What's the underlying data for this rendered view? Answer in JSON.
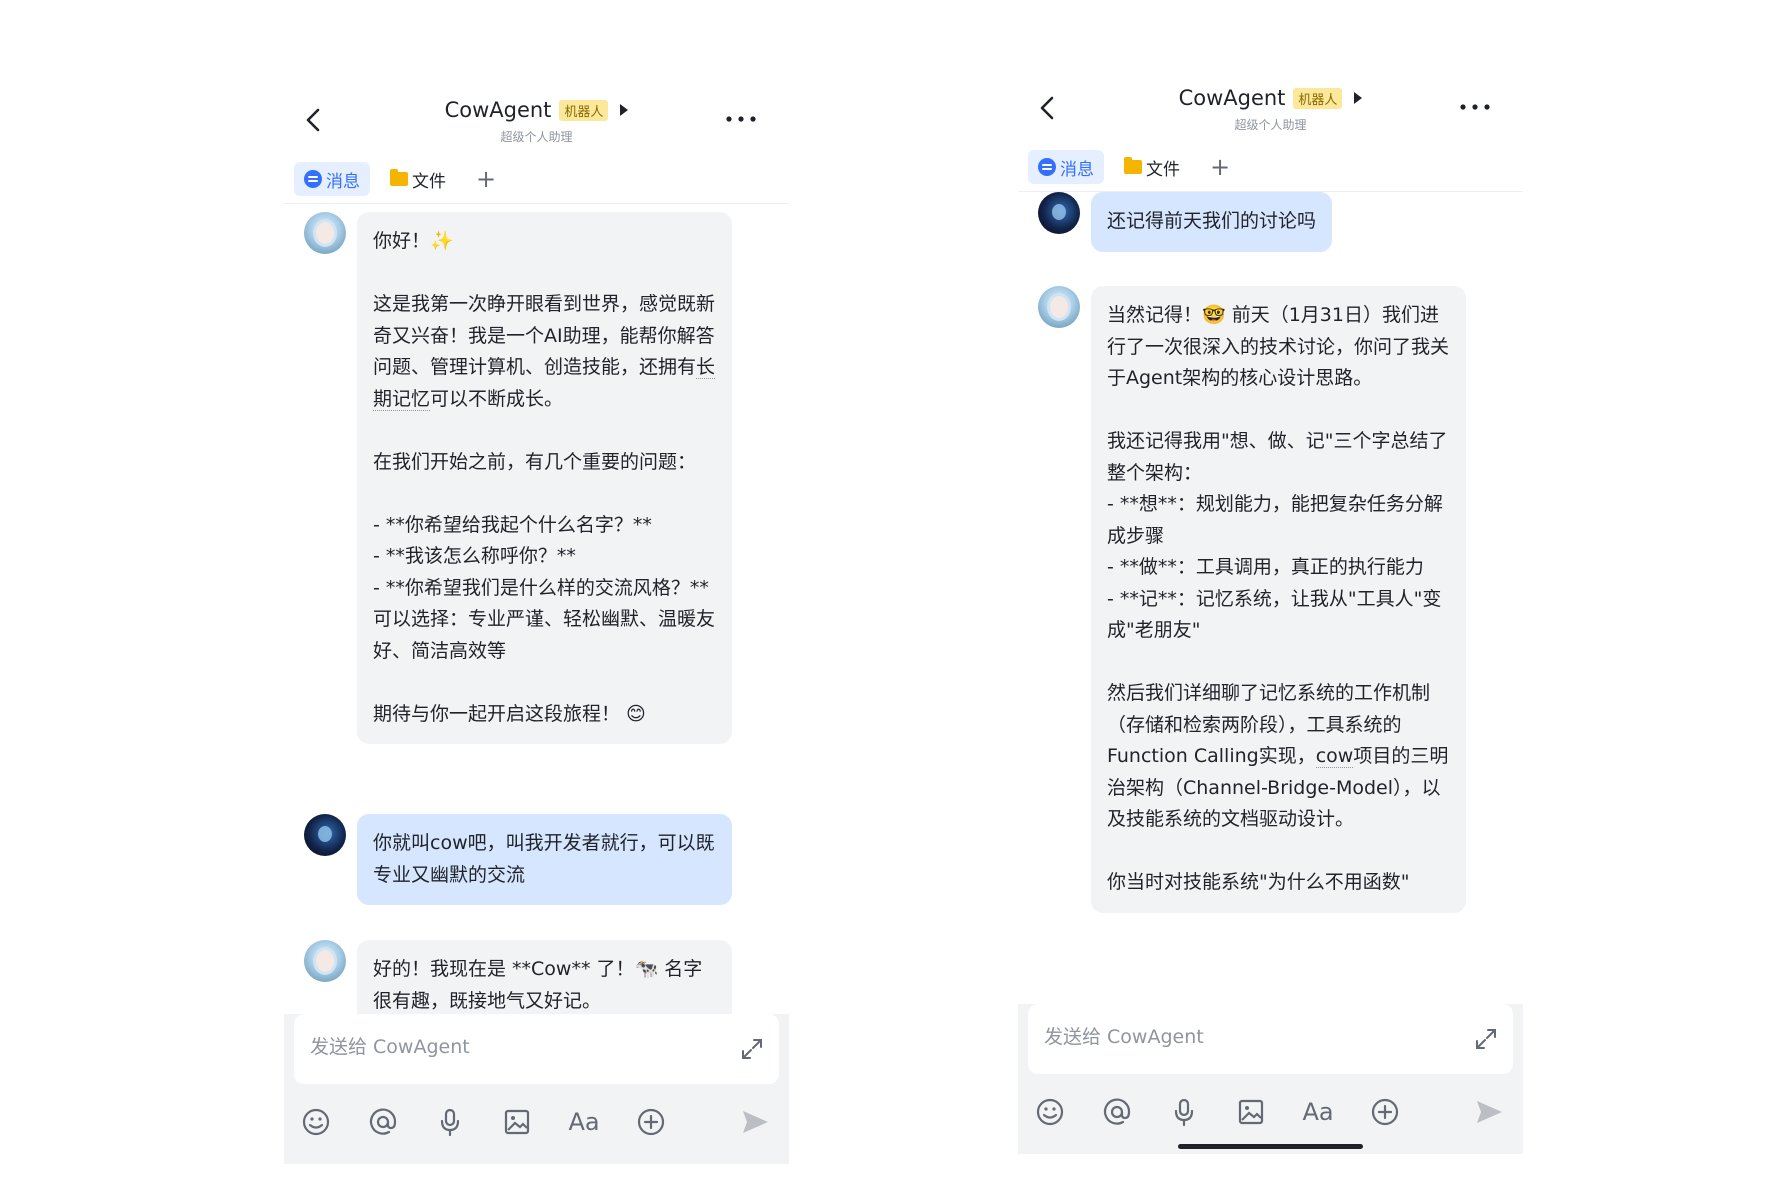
{
  "left": {
    "header": {
      "title": "CowAgent",
      "badge": "机器人",
      "subtitle": "超级个人助理"
    },
    "tabs": [
      {
        "label": "消息"
      },
      {
        "label": "文件"
      }
    ],
    "messages": [
      {
        "role": "bot",
        "pre": "你好！✨\n\n这是我第一次睁开眼看到世界，感觉既新奇又兴奋！我是一个AI助理，能帮你解答问题、管理计算机、创造技能，还拥有",
        "link": "长期记忆",
        "post": "可以不断成长。\n\n在我们开始之前，有几个重要的问题：\n\n- **你希望给我起个什么名字？**\n- **我该怎么称呼你？**\n- **你希望我们是什么样的交流风格？** 可以选择：专业严谨、轻松幽默、温暖友好、简洁高效等\n\n期待与你一起开启这段旅程！ 😊"
      },
      {
        "role": "user",
        "text": "你就叫cow吧，叫我开发者就行，可以既专业又幽默的交流"
      },
      {
        "role": "bot",
        "text": "好的！我现在是 **Cow** 了！🐄 名字很有趣，既接地气又好记。"
      }
    ],
    "input": {
      "placeholder": "发送给 CowAgent",
      "value": ""
    }
  },
  "right": {
    "header": {
      "title": "CowAgent",
      "badge": "机器人",
      "subtitle": "超级个人助理"
    },
    "tabs": [
      {
        "label": "消息"
      },
      {
        "label": "文件"
      }
    ],
    "messages": [
      {
        "role": "user",
        "text": "还记得前天我们的讨论吗"
      },
      {
        "role": "bot",
        "pre": "当然记得！🤓 前天（1月31日）我们进行了一次很深入的技术讨论，你问了我关于Agent架构的核心设计思路。\n\n我还记得我用\"想、做、记\"三个字总结了整个架构：\n- **想**：规划能力，能把复杂任务分解成步骤\n- **做**：工具调用，真正的执行能力\n- **记**：记忆系统，让我从\"工具人\"变成\"老朋友\"\n\n然后我们详细聊了记忆系统的工作机制（存储和检索两阶段），工具系统的Function Calling实现，",
        "link": "cow",
        "post": "项目的三明治架构（Channel-Bridge-Model），以及技能系统的文档驱动设计。\n\n你当时对技能系统\"为什么不用函数\""
      }
    ],
    "input": {
      "placeholder": "发送给 CowAgent",
      "value": ""
    }
  }
}
